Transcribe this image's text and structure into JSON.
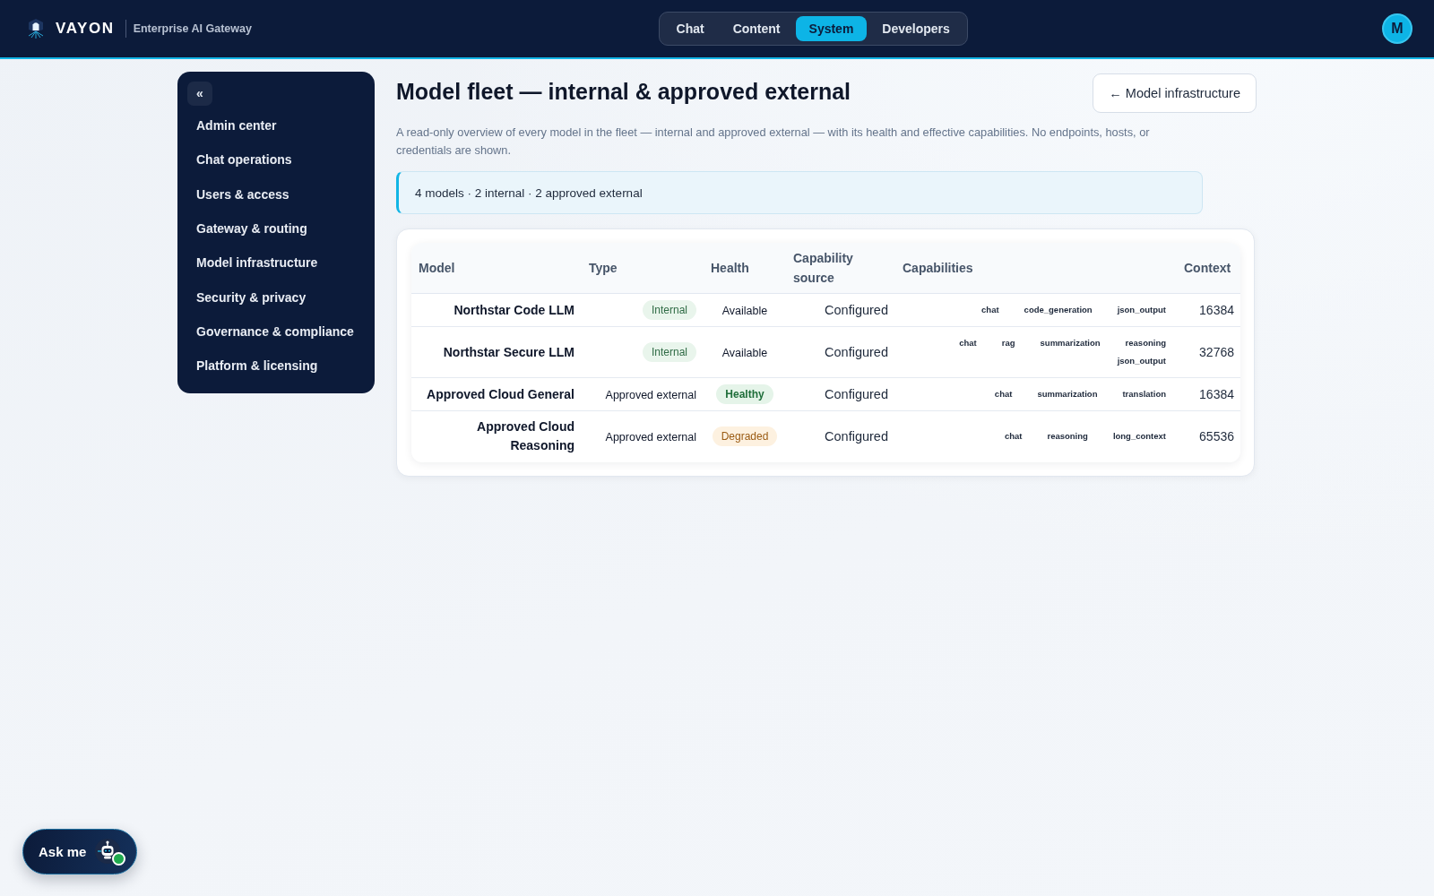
{
  "header": {
    "brand": "VAYON",
    "tagline": "Enterprise AI Gateway",
    "nav": [
      {
        "label": "Chat",
        "selected": false
      },
      {
        "label": "Content",
        "selected": false
      },
      {
        "label": "System",
        "selected": true
      },
      {
        "label": "Developers",
        "selected": false
      }
    ],
    "avatar": "M"
  },
  "sidebar": {
    "collapse_button": "«",
    "items": [
      "Admin center",
      "Chat operations",
      "Users & access",
      "Gateway & routing",
      "Model infrastructure",
      "Security & privacy",
      "Governance & compliance",
      "Platform & licensing"
    ]
  },
  "page": {
    "title": "Model fleet — internal & approved external",
    "back_button": "← Model infrastructure",
    "description": "A read-only overview of every model in the fleet — internal and approved external — with its health and effective capabilities. No endpoints, hosts, or credentials are shown.",
    "summary": "4 models · 2 internal · 2 approved external"
  },
  "table": {
    "columns": [
      "Model",
      "Type",
      "Health",
      "Capability source",
      "Capabilities",
      "Context"
    ],
    "rows": [
      {
        "model": "Northstar Code LLM",
        "type": {
          "label": "Internal",
          "kind": "pill"
        },
        "health": {
          "label": "Available",
          "kind": "plain"
        },
        "source": "Configured",
        "capabilities": [
          "chat",
          "code_generation",
          "json_output"
        ],
        "context": "16384"
      },
      {
        "model": "Northstar Secure LLM",
        "type": {
          "label": "Internal",
          "kind": "pill"
        },
        "health": {
          "label": "Available",
          "kind": "plain"
        },
        "source": "Configured",
        "capabilities": [
          "chat",
          "rag",
          "summarization",
          "reasoning",
          "json_output"
        ],
        "context": "32768"
      },
      {
        "model": "Approved Cloud General",
        "type": {
          "label": "Approved external",
          "kind": "plain"
        },
        "health": {
          "label": "Healthy",
          "kind": "success"
        },
        "source": "Configured",
        "capabilities": [
          "chat",
          "summarization",
          "translation"
        ],
        "context": "16384"
      },
      {
        "model": "Approved Cloud Reasoning",
        "type": {
          "label": "Approved external",
          "kind": "plain"
        },
        "health": {
          "label": "Degraded",
          "kind": "warning"
        },
        "source": "Configured",
        "capabilities": [
          "chat",
          "reasoning",
          "long_context"
        ],
        "context": "65536"
      }
    ]
  },
  "assistant": {
    "label": "Ask me"
  }
}
